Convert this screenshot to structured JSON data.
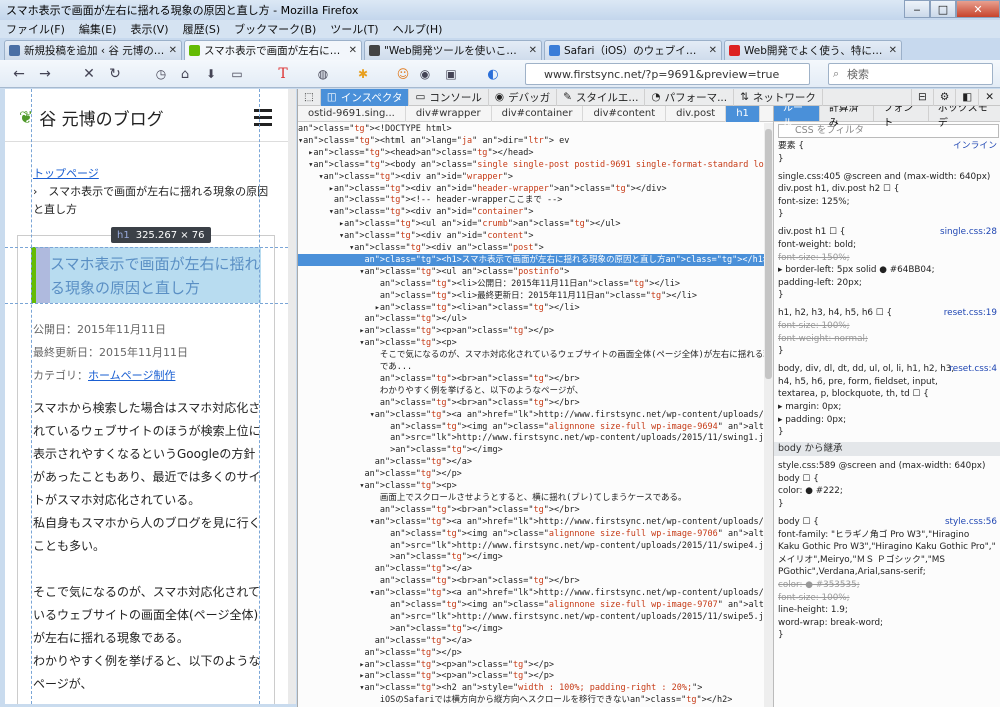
{
  "window": {
    "title": "スマホ表示で画面が左右に揺れる現象の原因と直し方 - Mozilla Firefox",
    "minimize": "‒",
    "maximize": "□",
    "close": "✕"
  },
  "menu": [
    "ファイル(F)",
    "編集(E)",
    "表示(V)",
    "履歴(S)",
    "ブックマーク(B)",
    "ツール(T)",
    "ヘルプ(H)"
  ],
  "tabs": [
    {
      "label": "新規投稿を追加 ‹ 谷 元博のブログ ...",
      "icon_color": "#4a6fa5"
    },
    {
      "label": "スマホ表示で画面が左右に揺れる現...",
      "icon_color": "#64BB04"
    },
    {
      "label": "\"Web開発ツールを使いこなせ!\"(ク...",
      "icon_color": "#444"
    },
    {
      "label": "Safari（iOS）のウェブインスペク...",
      "icon_color": "#3a7dd8"
    },
    {
      "label": "Web開発でよく使う、特に使えるC...",
      "icon_color": "#d22"
    }
  ],
  "tab_close": "✕",
  "nav": {
    "back": "←",
    "forward": "→",
    "stop": "✕",
    "reload": "↻",
    "url": "www.firstsync.net/?p=9691&preview=true",
    "search_placeholder": "検索"
  },
  "page": {
    "blog_title": "谷 元博のブログ",
    "leaf": "❦",
    "crumb_top": "トップページ",
    "crumb_current": "›　スマホ表示で画面が左右に揺れる現象の原因と直し方",
    "tooltip_tag": "h1",
    "tooltip_size": "325.267 × 76",
    "heading": "スマホ表示で画面が左右に揺れる現象の原因と直し方",
    "published": "公開日：2015年11月11日",
    "updated": "最終更新日：2015年11月11日",
    "category_label": "カテゴリ：",
    "category_link": "ホームページ制作",
    "p1": "スマホから検索した場合はスマホ対応化されているウェブサイトのほうが検索上位に表示されやすくなるというGoogleの方針があったこともあり、最近では多くのサイトがスマホ対応化されている。",
    "p2": "私自身もスマホから人のブログを見に行くことも多い。",
    "p3": "そこで気になるのが、スマホ対応化されているウェブサイトの画面全体(ページ全体)が左右に揺れる現象である。",
    "p4": "わかりやすく例を挙げると、以下のようなページが、"
  },
  "devtools": {
    "tabs": [
      "インスペクタ",
      "コンソール",
      "デバッガ",
      "スタイルエ...",
      "パフォーマ...",
      "ネットワーク"
    ],
    "breadcrumbs": [
      "ostid-9691.sing...",
      "div#wrapper",
      "div#container",
      "div#content",
      "div.post",
      "h1"
    ],
    "markup": [
      "<!DOCTYPE html>",
      "▾<html lang=\"ja\" dir=\"ltr\"> ev",
      "  ▸<head></head>",
      "  ▾<body class=\"single single-post postid-9691 single-format-standard logged-in\">",
      "    ▾<div id=\"wrapper\">",
      "      ▸<div id=\"header-wrapper\"></div>",
      "       <!-- header-wrapperここまで -->",
      "      ▾<div id=\"container\">",
      "        ▸<ul id=\"crumb\"></ul>",
      "        ▾<div id=\"content\">",
      "          ▾<div class=\"post\">",
      "             <h1>スマホ表示で画面が左右に揺れる現象の原因と直し方</h1>",
      "            ▾<ul class=\"postinfo\">",
      "                <li>公開日：2015年11月11日</li>",
      "                <li>最終更新日：2015年11月11日</li>",
      "               ▸<li></li>",
      "             </ul>",
      "            ▸<p></p>",
      "            ▾<p>",
      "                そこで気になるのが、スマホ対応化されているウェブサイトの画面全体(ページ全体)が左右に揺れる現象",
      "                であ...",
      "                <br></br>",
      "                わかりやすく例を挙げると、以下のようなページが、",
      "                <br></br>",
      "              ▾<a href=\"http://www.firstsync.net/wp-content/uploads/2015/11/swing1.jpg\"> ev",
      "                  <img class=\"alignnone size-full wp-image-9694\" alt=\"スマホ対応化されたページ\"",
      "                  src=\"http://www.firstsync.net/wp-content/uploads/2015/11/swing1.jpg\" style=\"opacity: 1;\"",
      "                  ></img>",
      "               </a>",
      "             </p>",
      "            ▾<p>",
      "                画面上でスクロールさせようとすると、横に揺れ(ブレ)てしまうケースである。",
      "                <br></br>",
      "              ▾<a href=\"http://www.firstsync.net/wp-content/uploads/2015/11/swipe4.jpg\"> ev",
      "                  <img class=\"alignnone size-full wp-image-9706\" alt=\"スワイプしたら横にブレる\"",
      "                  src=\"http://www.firstsync.net/wp-content/uploads/2015/11/swipe4.jpg\" style=\"opacity: 1;\"",
      "                  ></img>",
      "               </a>",
      "                <br></br>",
      "              ▾<a href=\"http://www.firstsync.net/wp-content/uploads/2015/11/swipe5.jpg\"> ev",
      "                  <img class=\"alignnone size-full wp-image-9707\" alt=\"ページ全体が左右にブレる\"",
      "                  src=\"http://www.firstsync.net/wp-content/uploads/2015/11/swipe5.jpg\" style=\"opacity: 1;\"",
      "                  ></img>",
      "               </a>",
      "             </p>",
      "            ▸<p></p>",
      "            ▸<p></p>",
      "            ▾<h2 style=\"width : 100%; padding-right : 20%;\">",
      "                iOSのSafariでは横方向から縦方向へスクロールを移行できない</h2>",
      "            ▸<p>"
    ],
    "rule_tabs": [
      "ルール",
      "計算済み",
      "フォント",
      "ボックスモデ"
    ],
    "filter_placeholder": "CSS をフィルタ",
    "rules": [
      {
        "t": "要素 {",
        "src": "インライン"
      },
      {
        "t": "}",
        "src": ""
      },
      {
        "t": "            single.css:405 @screen and (max-width: 640px)",
        "src": ""
      },
      {
        "t": "div.post h1, div.post h2 ☐ {",
        "src": ""
      },
      {
        "t": "      font-size: 125%;",
        "src": ""
      },
      {
        "t": "}",
        "src": ""
      },
      {
        "t": "div.post h1 ☐ {",
        "src": "single.css:28"
      },
      {
        "t": "      font-weight: bold;",
        "src": ""
      },
      {
        "t": "      font-size: 150%;",
        "src": "",
        "strike": true
      },
      {
        "t": "   ▸ border-left: 5px solid ● #64BB04;",
        "src": ""
      },
      {
        "t": "      padding-left: 20px;",
        "src": ""
      },
      {
        "t": "}",
        "src": ""
      },
      {
        "t": "h1, h2, h3, h4, h5, h6 ☐ {",
        "src": "reset.css:19"
      },
      {
        "t": "      font-size: 100%;",
        "src": "",
        "strike": true
      },
      {
        "t": "      font-weight: normal;",
        "src": "",
        "strike": true
      },
      {
        "t": "}",
        "src": ""
      },
      {
        "t": "body, div, dl, dt, dd, ul, ol, li, h1, h2, h3,",
        "src": "reset.css:4"
      },
      {
        "t": "h4, h5, h6, pre, form, fieldset, input,",
        "src": ""
      },
      {
        "t": "textarea, p, blockquote, th, td ☐ {",
        "src": ""
      },
      {
        "t": "   ▸ margin: 0px;",
        "src": ""
      },
      {
        "t": "   ▸ padding: 0px;",
        "src": ""
      },
      {
        "t": "}",
        "src": ""
      }
    ],
    "inherit_label": "body から継承",
    "rules2": [
      {
        "t": "            style.css:589 @screen and (max-width: 640px)",
        "src": ""
      },
      {
        "t": "body ☐ {",
        "src": ""
      },
      {
        "t": "      color: ● #222;",
        "src": ""
      },
      {
        "t": "}",
        "src": ""
      },
      {
        "t": "body ☐ {",
        "src": "style.css:56"
      },
      {
        "t": "      font-family: \"ヒラギノ角ゴ Pro W3\",\"Hiragino",
        "src": ""
      },
      {
        "t": "      Kaku Gothic Pro W3\",\"Hiragino Kaku Gothic Pro\",\"",
        "src": ""
      },
      {
        "t": "      メイリオ\",Meiryo,\"ＭＳ Ｐゴシック\",\"MS",
        "src": ""
      },
      {
        "t": "      PGothic\",Verdana,Arial,sans-serif;",
        "src": ""
      },
      {
        "t": "      color: ● #353535;",
        "src": "",
        "strike": true
      },
      {
        "t": "      font-size: 100%;",
        "src": "",
        "strike": true
      },
      {
        "t": "      line-height: 1.9;",
        "src": ""
      },
      {
        "t": "      word-wrap: break-word;",
        "src": ""
      },
      {
        "t": "}",
        "src": ""
      }
    ]
  }
}
